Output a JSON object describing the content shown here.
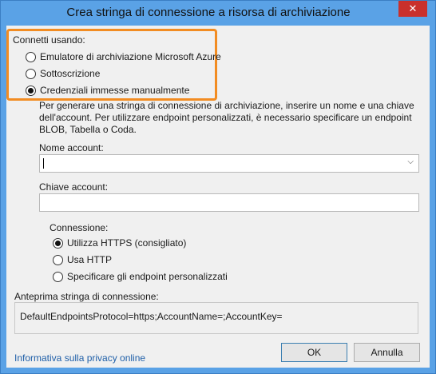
{
  "window": {
    "title": "Crea stringa di connessione a risorsa di archiviazione",
    "close_glyph": "✕"
  },
  "connect": {
    "label": "Connetti usando:",
    "options": [
      {
        "label": "Emulatore di archiviazione Microsoft Azure",
        "checked": false
      },
      {
        "label": "Sottoscrizione",
        "checked": false
      },
      {
        "label": "Credenziali immesse manualmente",
        "checked": true
      }
    ]
  },
  "description": "Per generare una stringa di connessione di archiviazione, inserire un nome e una chiave dell'account. Per utilizzare endpoint personalizzati, è necessario specificare un endpoint BLOB, Tabella o Coda.",
  "account_name": {
    "label": "Nome account:",
    "value": ""
  },
  "account_key": {
    "label": "Chiave account:",
    "value": ""
  },
  "connection": {
    "label": "Connessione:",
    "options": [
      {
        "label": "Utilizza HTTPS (consigliato)",
        "checked": true
      },
      {
        "label": "Usa HTTP",
        "checked": false
      },
      {
        "label": "Specificare gli endpoint personalizzati",
        "checked": false
      }
    ]
  },
  "preview": {
    "label": "Anteprima stringa di connessione:",
    "value": "DefaultEndpointsProtocol=https;AccountName=;AccountKey="
  },
  "footer": {
    "privacy_link": "Informativa sulla privacy online",
    "ok_label": "OK",
    "cancel_label": "Annulla"
  }
}
